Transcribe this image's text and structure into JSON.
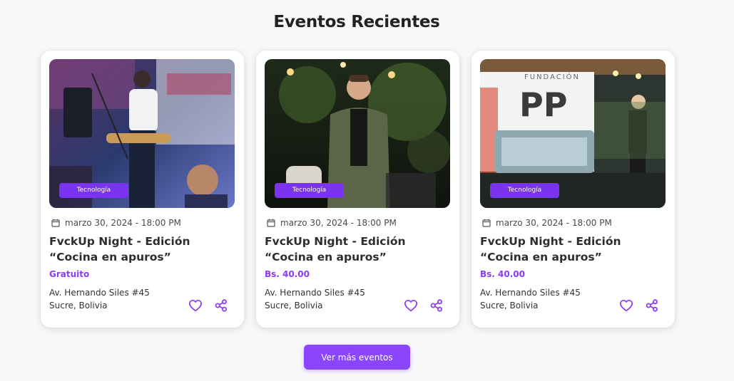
{
  "section": {
    "title": "Eventos Recientes"
  },
  "events": [
    {
      "category": "Tecnología",
      "date": "marzo 30, 2024 - 18:00 PM",
      "title": "FvckUp Night - Edición “Cocina en apuros”",
      "price": "Gratuito",
      "address_line1": "Av. Hernando Siles #45",
      "address_line2": "Sucre, Bolivia"
    },
    {
      "category": "Tecnología",
      "date": "marzo 30, 2024 - 18:00 PM",
      "title": "FvckUp Night - Edición “Cocina en apuros”",
      "price": "Bs. 40.00",
      "address_line1": "Av. Hernando Siles #45",
      "address_line2": "Sucre, Bolivia"
    },
    {
      "category": "Tecnología",
      "date": "marzo 30, 2024 - 18:00 PM",
      "title": "FvckUp Night - Edición “Cocina en apuros”",
      "price": "Bs. 40.00",
      "address_line1": "Av. Hernando Siles #45",
      "address_line2": "Sucre, Bolivia",
      "image_sign_top": "FUNDACIÓN",
      "image_sign_logo": "PP"
    }
  ],
  "icons": {
    "date": "calendar-icon",
    "favorite": "heart-icon",
    "share": "share-icon"
  },
  "more_button": {
    "label": "Ver más eventos"
  },
  "colors": {
    "accent": "#8b46fb",
    "badge": "#7a34f0",
    "price": "#8a3cf5",
    "background": "#f8f8f9"
  }
}
